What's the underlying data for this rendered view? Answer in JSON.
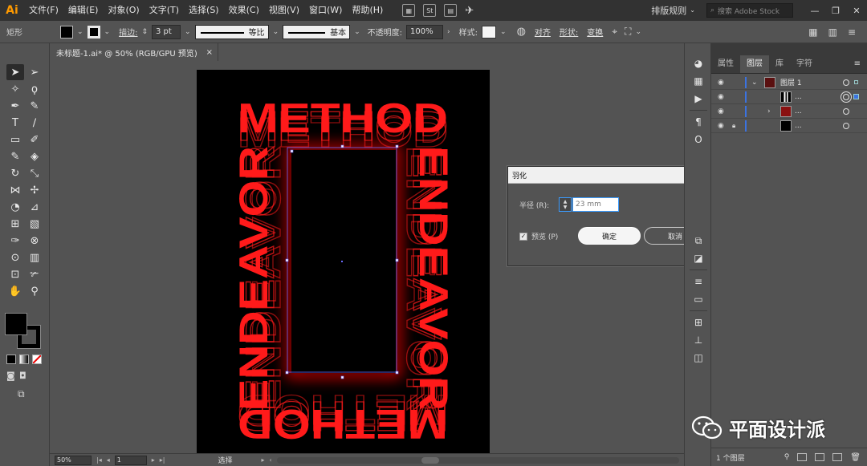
{
  "app": {
    "logo": "Ai",
    "menu": [
      "文件(F)",
      "编辑(E)",
      "对象(O)",
      "文字(T)",
      "选择(S)",
      "效果(C)",
      "视图(V)",
      "窗口(W)",
      "帮助(H)"
    ],
    "menu_icons": [
      "St"
    ],
    "workspace": "排版规则",
    "stock_search_placeholder": "搜索 Adobe Stock",
    "window_buttons": [
      "—",
      "❐",
      "✕"
    ]
  },
  "control_bar": {
    "object_type": "矩形",
    "stroke_label": "描边:",
    "stroke_weight": "3 pt",
    "stroke_profile": "等比",
    "brush_def": "基本",
    "opacity_label": "不透明度:",
    "opacity_value": "100%",
    "style_label": "样式:",
    "align_label": "对齐",
    "shape_label": "形状:",
    "transform_label": "变换"
  },
  "document": {
    "tab_title": "未标题-1.ai* @ 50% (RGB/GPU 预览)",
    "close": "×",
    "artwork_text": {
      "top": "METHOD",
      "bottom": "METHOD",
      "left": "ENDEAVOR",
      "right": "ENDEAVOR"
    },
    "colors": {
      "artwork": "#ff1a1a",
      "artboard": "#000000"
    }
  },
  "feather_dialog": {
    "title": "羽化",
    "radius_label": "半径 (R):",
    "radius_value": "23 mm",
    "preview_label": "预览 (P)",
    "preview_checked": true,
    "ok_label": "确定",
    "cancel_label": "取消"
  },
  "layers_panel": {
    "tabs": [
      "属性",
      "图层",
      "库",
      "字符"
    ],
    "active_tab": "图层",
    "rows": [
      {
        "name": "图层 1",
        "expanded": true,
        "locked": false
      },
      {
        "name": "...",
        "expanded": false,
        "locked": false
      },
      {
        "name": "...",
        "expanded": false,
        "locked": false,
        "has_children": true
      },
      {
        "name": "...",
        "expanded": false,
        "locked": true
      }
    ],
    "footer": "1 个图层"
  },
  "status_bar": {
    "zoom": "50%",
    "page": "1",
    "tool": "选择"
  },
  "watermark": "平面设计派"
}
